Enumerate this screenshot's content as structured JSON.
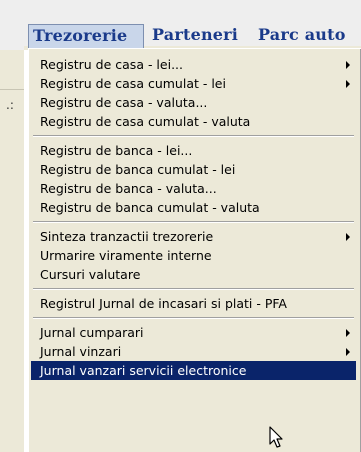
{
  "menubar": {
    "items": [
      {
        "label": "Trezorerie",
        "active": true
      },
      {
        "label": "Parteneri"
      },
      {
        "label": "Parc auto"
      }
    ]
  },
  "dropdown": {
    "groups": [
      [
        {
          "label": "Registru de casa - lei...",
          "submenu": true
        },
        {
          "label": "Registru de casa cumulat - lei",
          "submenu": true
        },
        {
          "label": "Registru de casa - valuta...",
          "submenu": false
        },
        {
          "label": "Registru de casa cumulat - valuta",
          "submenu": false
        }
      ],
      [
        {
          "label": "Registru de banca - lei...",
          "submenu": false
        },
        {
          "label": "Registru de banca cumulat - lei",
          "submenu": false
        },
        {
          "label": "Registru de banca - valuta...",
          "submenu": false
        },
        {
          "label": "Registru de banca cumulat - valuta",
          "submenu": false
        }
      ],
      [
        {
          "label": "Sinteza tranzactii trezorerie",
          "submenu": true
        },
        {
          "label": "Urmarire viramente interne",
          "submenu": false
        },
        {
          "label": "Cursuri valutare",
          "submenu": false
        }
      ],
      [
        {
          "label": "Registrul Jurnal de incasari si plati - PFA",
          "submenu": false
        }
      ],
      [
        {
          "label": "Jurnal cumparari",
          "submenu": true
        },
        {
          "label": "Jurnal vinzari",
          "submenu": true
        },
        {
          "label": "Jurnal vanzari servicii electronice",
          "submenu": false,
          "selected": true
        }
      ]
    ]
  },
  "background": {
    "left_glyph": ".:"
  },
  "colors": {
    "menu_title": "#1a3a8a",
    "menu_bg": "#ece9d8",
    "selection_bg": "#0a246a",
    "selection_fg": "#ffffff"
  }
}
